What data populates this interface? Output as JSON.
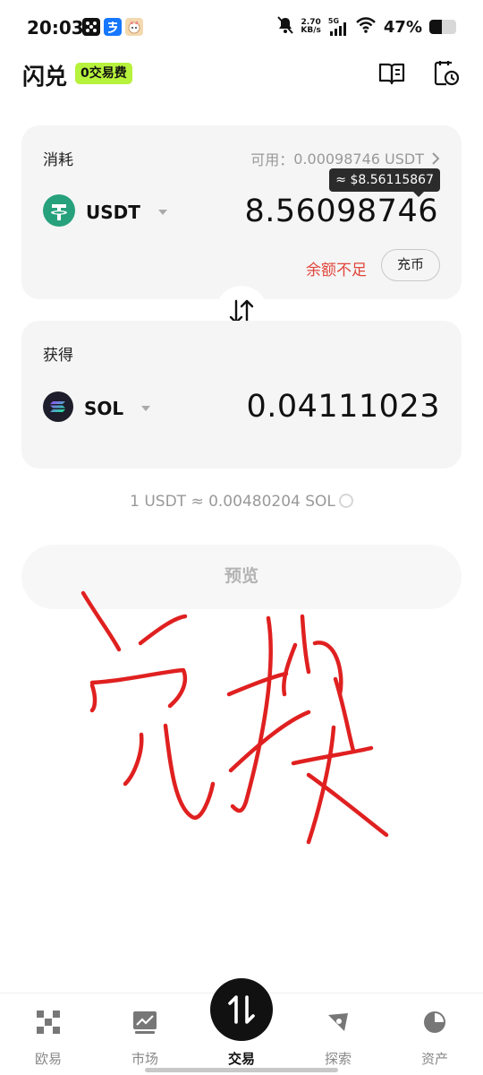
{
  "status_bar": {
    "time": "20:03",
    "network_speed_value": "2.70",
    "network_speed_unit": "KB/s",
    "network_type": "5G",
    "battery_percent": "47%",
    "battery_level": 0.47,
    "icons": [
      "app-dice-icon",
      "alipay-icon",
      "cat-app-icon",
      "mute-icon",
      "signal-icon",
      "wifi-icon",
      "battery-icon"
    ]
  },
  "header": {
    "title": "闪兑",
    "fee_badge": "0交易费",
    "icons": [
      "guide-book-icon",
      "history-icon"
    ]
  },
  "pay_card": {
    "label": "消耗",
    "available_label": "可用：",
    "available_value": "0.00098746 USDT",
    "token": "USDT",
    "token_icon": "tether-icon",
    "token_color": "#26a17b",
    "amount": "8.56098746",
    "usd_tooltip": "≈ $8.56115867",
    "insufficient_text": "余额不足",
    "topup_label": "充币"
  },
  "receive_card": {
    "label": "获得",
    "token": "SOL",
    "token_icon": "solana-icon",
    "amount": "0.04111023"
  },
  "rate_text": "1 USDT ≈ 0.00480204 SOL",
  "preview_label": "预览",
  "handwriting_color": "#e02020",
  "bottom_nav": {
    "items": [
      {
        "label": "欧易",
        "icon": "okx-logo-icon"
      },
      {
        "label": "市场",
        "icon": "market-chart-icon"
      },
      {
        "label": "交易",
        "icon": "trade-swap-icon"
      },
      {
        "label": "探索",
        "icon": "explore-compass-icon"
      },
      {
        "label": "资产",
        "icon": "assets-pie-icon"
      }
    ],
    "active": "交易"
  },
  "colors": {
    "accent_badge": "#b7f23c",
    "warning_red": "#e0453c",
    "card_bg": "#f5f5f5"
  }
}
